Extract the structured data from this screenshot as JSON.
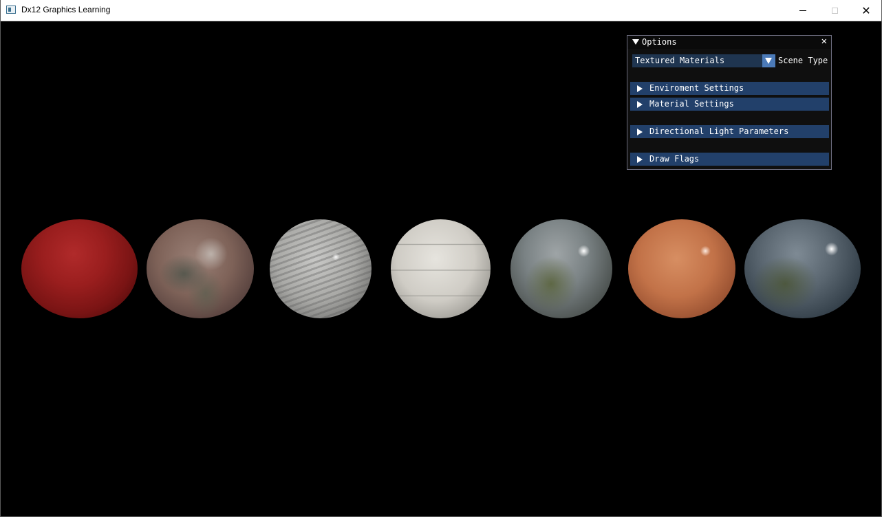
{
  "window": {
    "title": "Dx12 Graphics Learning",
    "controls": {
      "minimize": "—",
      "maximize": "☐",
      "close": "✕"
    }
  },
  "viewport": {
    "background": "#000000",
    "spheres": [
      {
        "name": "red",
        "color": "#9a1e1e"
      },
      {
        "name": "rusted-metal",
        "color": "#7e6258"
      },
      {
        "name": "granite",
        "color": "#a9a9a6"
      },
      {
        "name": "tiles",
        "color": "#cfccc5"
      },
      {
        "name": "chrome-light",
        "color": "#7a8284"
      },
      {
        "name": "copper",
        "color": "#c27248"
      },
      {
        "name": "chrome-dark",
        "color": "#5a6670"
      }
    ]
  },
  "options_panel": {
    "title": "Options",
    "close_glyph": "✕",
    "scene_type": {
      "selected": "Textured Materials",
      "label": "Scene Type"
    },
    "headers": [
      {
        "label": "Enviroment Settings"
      },
      {
        "label": "Material Settings"
      },
      {
        "label": "Directional Light Parameters"
      },
      {
        "label": "Draw Flags"
      }
    ],
    "colors": {
      "header_bg": "#22406a",
      "combo_bg": "#1f3550",
      "combo_button": "#4b7ab8",
      "window_bg": "#0f0f0f"
    }
  }
}
